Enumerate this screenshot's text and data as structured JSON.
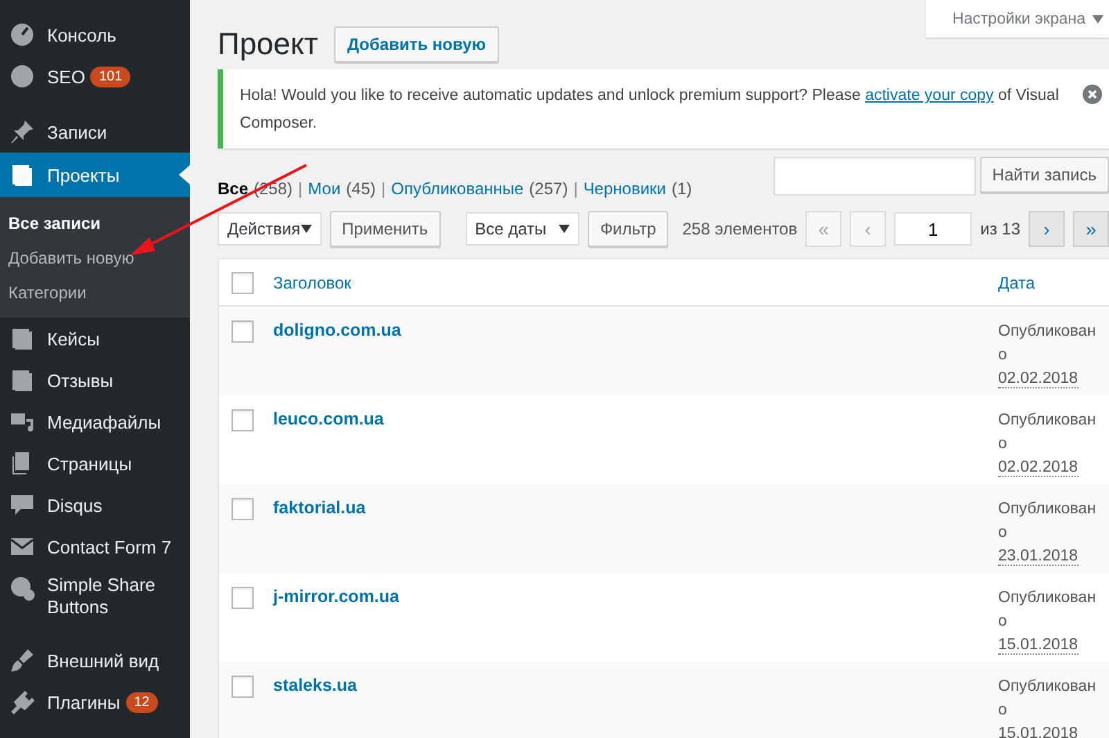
{
  "sidebar": {
    "items": [
      {
        "label": "Консоль",
        "selected": false
      },
      {
        "label": "SEO",
        "selected": false,
        "count": "101"
      },
      {
        "label": "Записи",
        "selected": false
      },
      {
        "label": "Проекты",
        "selected": true,
        "submenu": [
          {
            "label": "Все записи",
            "selected": true
          },
          {
            "label": "Добавить новую",
            "selected": false
          },
          {
            "label": "Категории",
            "selected": false
          }
        ]
      },
      {
        "label": "Кейсы",
        "selected": false
      },
      {
        "label": "Отзывы",
        "selected": false
      },
      {
        "label": "Медиафайлы",
        "selected": false
      },
      {
        "label": "Страницы",
        "selected": false
      },
      {
        "label": "Disqus",
        "selected": false
      },
      {
        "label": "Contact Form 7",
        "selected": false
      },
      {
        "label": "Simple Share Buttons",
        "selected": false
      },
      {
        "label": "Внешний вид",
        "selected": false
      },
      {
        "label": "Плагины",
        "selected": false,
        "count": "12"
      }
    ]
  },
  "screen_options": "Настройки экрана",
  "page_title": "Проект",
  "add_new": "Добавить новую",
  "notice": {
    "text_before": "Hola! Would you like to receive automatic updates and unlock premium support? Please ",
    "link": "activate your copy",
    "text_after": " of Visual Composer."
  },
  "view_separator": "|",
  "views": [
    {
      "label": "Все",
      "count": "(258)",
      "selected": true
    },
    {
      "label": "Мои",
      "count": "(45)",
      "selected": false
    },
    {
      "label": "Опубликованные",
      "count": "(257)",
      "selected": false
    },
    {
      "label": "Черновики",
      "count": "(1)",
      "selected": false
    }
  ],
  "search": {
    "button": "Найти запись"
  },
  "bulk_action": "Действия",
  "apply": "Применить",
  "date_filter": "Все даты",
  "filter": "Фильтр",
  "pagination": {
    "count": "258 элементов",
    "first": "«",
    "prev": "‹",
    "page": "1",
    "of": "из 13",
    "next": "›",
    "last": "»"
  },
  "table": {
    "select_all_checked": false,
    "columns": [
      "Заголовок",
      "Дата"
    ],
    "rows": [
      {
        "title": "doligno.com.ua",
        "status": "Опубликовано",
        "date": "02.02.2018",
        "checked": false
      },
      {
        "title": "leuco.com.ua",
        "status": "Опубликовано",
        "date": "02.02.2018",
        "checked": false
      },
      {
        "title": "faktorial.ua",
        "status": "Опубликовано",
        "date": "23.01.2018",
        "checked": false
      },
      {
        "title": "j-mirror.com.ua",
        "status": "Опубликовано",
        "date": "15.01.2018",
        "checked": false
      },
      {
        "title": "staleks.ua",
        "status": "Опубликовано",
        "date": "15.01.2018",
        "checked": false
      }
    ]
  }
}
